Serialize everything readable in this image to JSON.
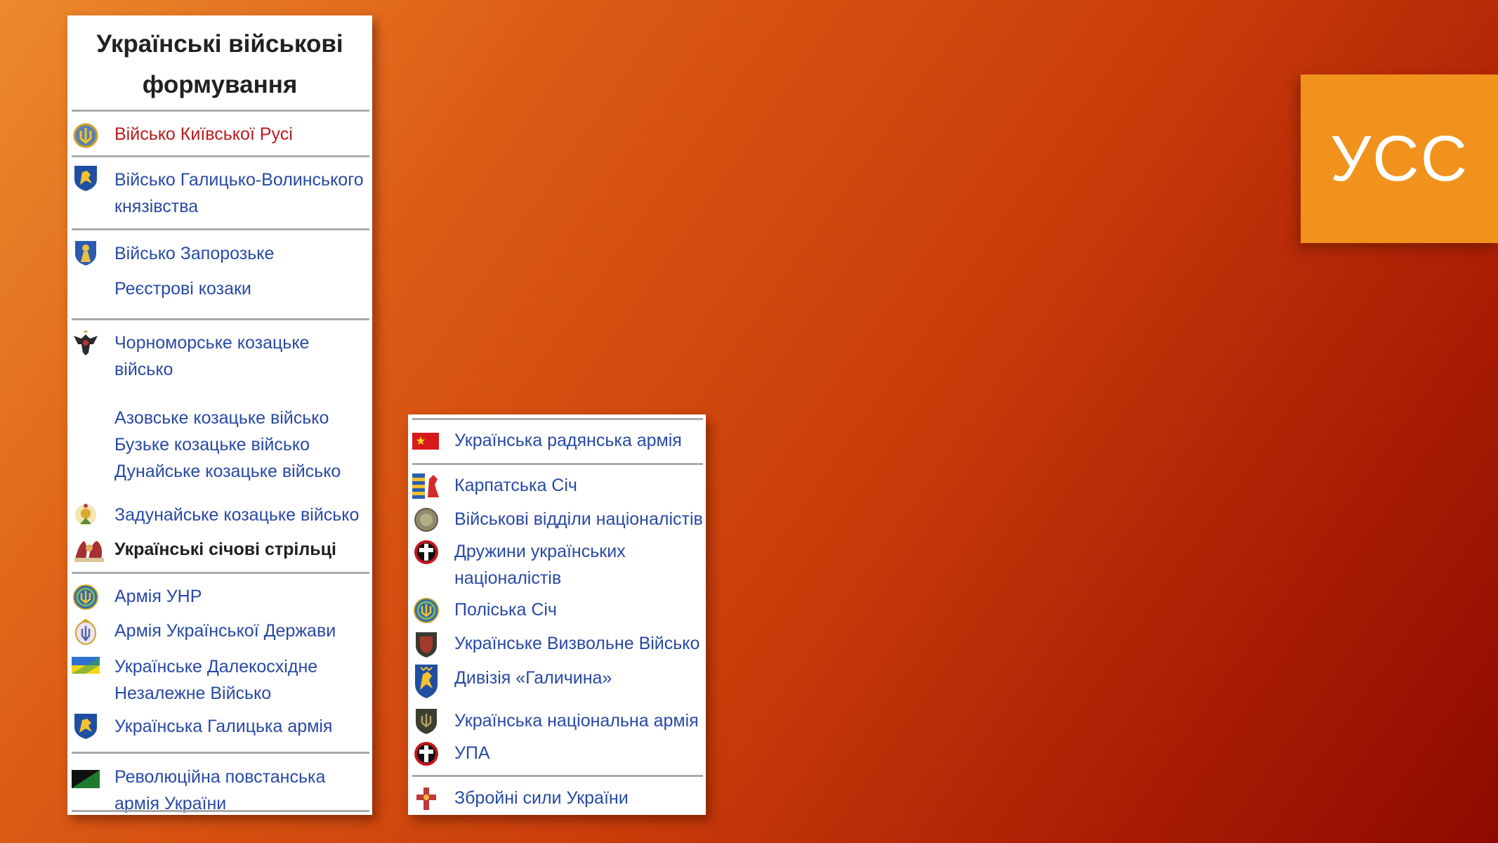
{
  "navbox_left": {
    "title_line1": "Українські військові",
    "title_line2": "формування",
    "items": [
      {
        "label": "Військо Київської Русі",
        "icon": "trident-emblem-icon"
      },
      {
        "label": "Військо Галицько-Волинського",
        "label_line2": "князівства",
        "icon": "lion-shield-icon"
      },
      {
        "label": "Військо Запорозьке",
        "icon": "cossack-emblem-icon"
      },
      {
        "label": "Реєстрові козаки"
      },
      {
        "label": "Чорноморське козацьке",
        "label_line2": "військо",
        "icon": "double-eagle-icon"
      },
      {
        "label": "Азовське козацьке військо"
      },
      {
        "label": "Бузьке козацьке військо"
      },
      {
        "label": "Дунайське козацьке військо"
      },
      {
        "label": "Задунайське козацьке військо",
        "icon": "ottoman-emblem-icon"
      },
      {
        "label": "Українські січові стрільці",
        "icon": "usс-emblem-icon"
      },
      {
        "label": "Армія УНР",
        "icon": "unr-trident-icon"
      },
      {
        "label": "Армія Української Держави",
        "icon": "hetmanate-emblem-icon"
      },
      {
        "label": "Українське Далекосхідне",
        "label_line2": "Незалежне Військо",
        "icon": "blue-yellow-flag-icon"
      },
      {
        "label": "Українська Галицька армія",
        "icon": "galician-lion-icon"
      },
      {
        "label": "Революційна повстанська",
        "label_line2": "армія України",
        "icon": "black-green-flag-icon"
      }
    ]
  },
  "navbox_right": {
    "items": [
      {
        "label": "Українська радянська армія",
        "icon": "soviet-flag-icon"
      },
      {
        "label": "Карпатська Січ",
        "icon": "carpathian-flag-icon"
      },
      {
        "label": "Військові відділи націоналістів",
        "icon": "round-badge-icon"
      },
      {
        "label": "Дружини українських",
        "label_line2": "націоналістів",
        "icon": "cross-badge-icon"
      },
      {
        "label": "Поліська Січ",
        "icon": "polissia-trident-icon"
      },
      {
        "label": "Українське Визвольне Військо",
        "icon": "dark-shield-icon"
      },
      {
        "label": "Дивізія «Галичина»",
        "icon": "galicia-division-icon"
      },
      {
        "label": "Українська національна армія",
        "icon": "una-shield-icon"
      },
      {
        "label": "УПА",
        "icon": "upa-cross-icon"
      },
      {
        "label": "Збройні сили України",
        "icon": "armed-forces-cross-icon"
      }
    ]
  },
  "slide_tag": {
    "text": "УСС"
  },
  "colors": {
    "link": "#2849a6",
    "link_missing": "#ba1a1a",
    "tag_background": "#f0921c"
  }
}
